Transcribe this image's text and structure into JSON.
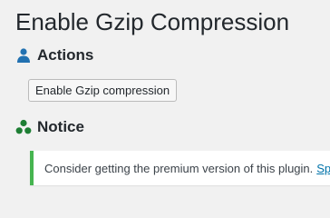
{
  "page": {
    "title": "Enable Gzip Compression"
  },
  "actions": {
    "heading": "Actions",
    "icon": "user-icon",
    "button_label": "Enable Gzip compression"
  },
  "notice": {
    "heading": "Notice",
    "icon": "group-icon",
    "message": "Consider getting the premium version of this plugin.",
    "link_text": "Sp"
  },
  "colors": {
    "icon_blue": "#2271b1",
    "icon_green": "#1e7e34",
    "notice_border": "#46b450",
    "link": "#0073aa"
  }
}
